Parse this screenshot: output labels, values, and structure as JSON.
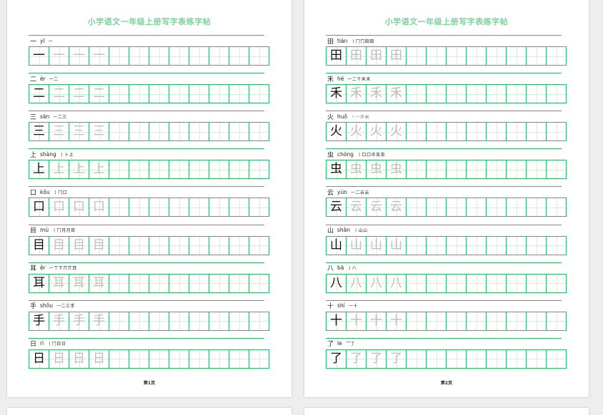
{
  "pages": [
    {
      "title": "小学语文一年级上册写字表练字帖",
      "footer": "第1页",
      "rows": [
        {
          "char": "一",
          "pinyin": "yī",
          "strokes": "一"
        },
        {
          "char": "二",
          "pinyin": "èr",
          "strokes": "一二"
        },
        {
          "char": "三",
          "pinyin": "sān",
          "strokes": "一二三"
        },
        {
          "char": "上",
          "pinyin": "shàng",
          "strokes": "丨卜上"
        },
        {
          "char": "口",
          "pinyin": "kǒu",
          "strokes": "丨冂口"
        },
        {
          "char": "目",
          "pinyin": "mù",
          "strokes": "丨冂月月目"
        },
        {
          "char": "耳",
          "pinyin": "ěr",
          "strokes": "一丅下丌丌耳"
        },
        {
          "char": "手",
          "pinyin": "shǒu",
          "strokes": "一二三手"
        },
        {
          "char": "日",
          "pinyin": "rì",
          "strokes": "丨冂日日"
        }
      ]
    },
    {
      "title": "小学语文一年级上册写字表练字帖",
      "footer": "第2页",
      "rows": [
        {
          "char": "田",
          "pinyin": "tián",
          "strokes": "丨冂冂田田"
        },
        {
          "char": "禾",
          "pinyin": "hé",
          "strokes": "一二千禾禾"
        },
        {
          "char": "火",
          "pinyin": "huǒ",
          "strokes": "丶丷少火"
        },
        {
          "char": "虫",
          "pinyin": "chóng",
          "strokes": "丨口口中虫虫"
        },
        {
          "char": "云",
          "pinyin": "yún",
          "strokes": "一二云云"
        },
        {
          "char": "山",
          "pinyin": "shān",
          "strokes": "丨山山"
        },
        {
          "char": "八",
          "pinyin": "bā",
          "strokes": "丿八"
        },
        {
          "char": "十",
          "pinyin": "shí",
          "strokes": "一十"
        },
        {
          "char": "了",
          "pinyin": "le",
          "strokes": "乛了"
        }
      ]
    }
  ],
  "layout_info": {
    "cells_per_row": 12,
    "trace_copies": 3
  },
  "colors": {
    "grid": "#2cb76a",
    "title": "#7dd29b",
    "model_char": "#111111",
    "trace_char": "#bdbdbd"
  }
}
